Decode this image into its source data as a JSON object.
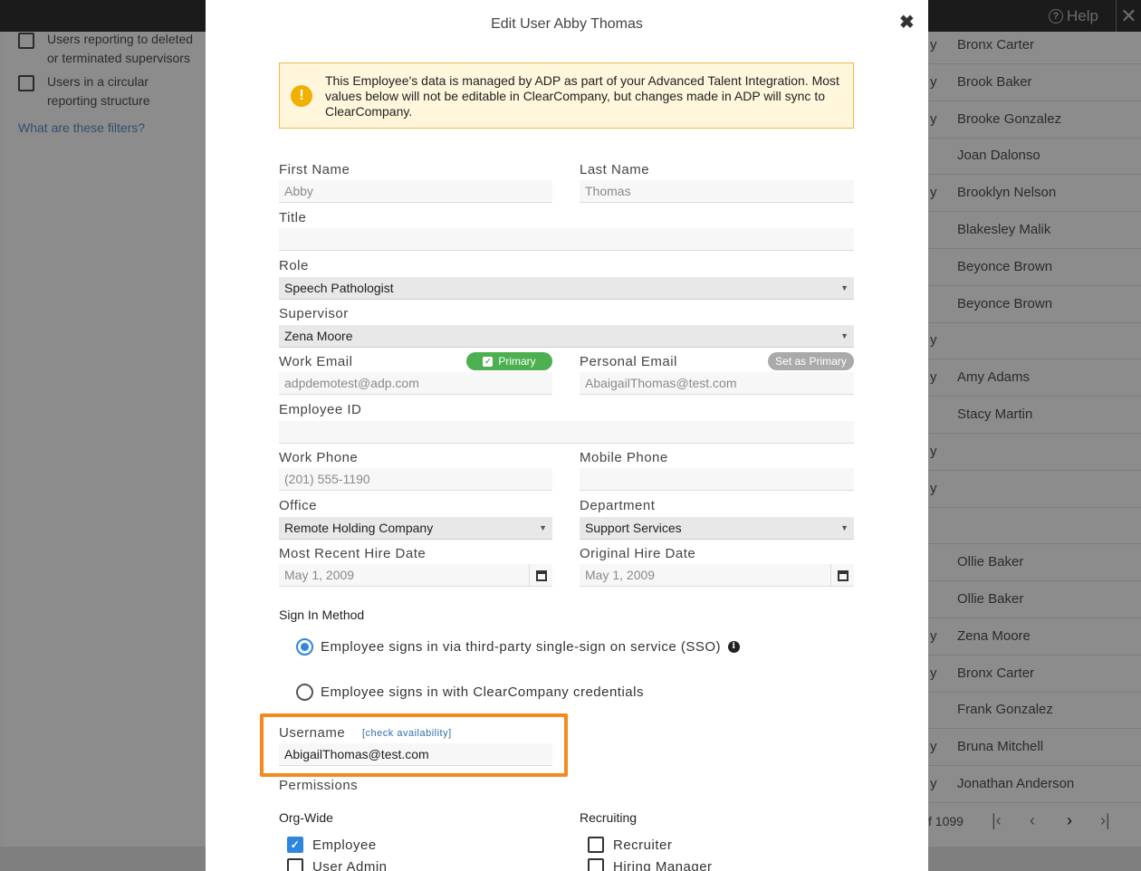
{
  "background": {
    "help_label": "Help",
    "filters": [
      {
        "line1": "Users reporting to deleted",
        "line2": "or terminated supervisors"
      },
      {
        "line1": "Users in a circular",
        "line2": "reporting structure"
      }
    ],
    "filters_link": "What are these filters?",
    "rows": [
      {
        "suffix": "y",
        "name": "Bronx Carter"
      },
      {
        "suffix": "y",
        "name": "Brook Baker"
      },
      {
        "suffix": "y",
        "name": "Brooke Gonzalez"
      },
      {
        "suffix": "",
        "name": "Joan Dalonso"
      },
      {
        "suffix": "y",
        "name": "Brooklyn Nelson"
      },
      {
        "suffix": "",
        "name": "Blakesley Malik"
      },
      {
        "suffix": "",
        "name": "Beyonce Brown"
      },
      {
        "suffix": "",
        "name": "Beyonce Brown"
      },
      {
        "suffix": "y",
        "name": ""
      },
      {
        "suffix": "y",
        "name": "Amy Adams"
      },
      {
        "suffix": "",
        "name": "Stacy Martin"
      },
      {
        "suffix": "y",
        "name": ""
      },
      {
        "suffix": "y",
        "name": ""
      },
      {
        "suffix": "",
        "name": ""
      },
      {
        "suffix": "",
        "name": "Ollie Baker"
      },
      {
        "suffix": "",
        "name": "Ollie Baker"
      },
      {
        "suffix": "y",
        "name": "Zena Moore"
      },
      {
        "suffix": "y",
        "name": "Bronx Carter"
      },
      {
        "suffix": "",
        "name": "Frank Gonzalez"
      },
      {
        "suffix": "y",
        "name": "Bruna Mitchell"
      },
      {
        "suffix": "y",
        "name": "Jonathan Anderson"
      }
    ],
    "pager_text": "f 1099"
  },
  "modal": {
    "title": "Edit User Abby Thomas",
    "alert_text": "This Employee's data is managed by ADP as part of your Advanced Talent Integration. Most values below will not be editable in ClearCompany, but changes made in ADP will sync to ClearCompany.",
    "first_name": {
      "label": "First Name",
      "value": "Abby"
    },
    "last_name": {
      "label": "Last Name",
      "value": "Thomas"
    },
    "title_field": {
      "label": "Title",
      "value": ""
    },
    "role": {
      "label": "Role",
      "value": "Speech Pathologist"
    },
    "supervisor": {
      "label": "Supervisor",
      "value": "Zena Moore"
    },
    "work_email": {
      "label": "Work Email",
      "value": "adpdemotest@adp.com",
      "badge": "Primary"
    },
    "personal_email": {
      "label": "Personal Email",
      "value": "AbaigailThomas@test.com",
      "badge": "Set as Primary"
    },
    "employee_id": {
      "label": "Employee ID",
      "value": ""
    },
    "work_phone": {
      "label": "Work Phone",
      "value": "(201) 555-1190"
    },
    "mobile_phone": {
      "label": "Mobile Phone",
      "value": ""
    },
    "office": {
      "label": "Office",
      "value": "Remote Holding Company"
    },
    "department": {
      "label": "Department",
      "value": "Support Services"
    },
    "recent_hire": {
      "label": "Most Recent Hire Date",
      "value": "May 1, 2009"
    },
    "original_hire": {
      "label": "Original Hire Date",
      "value": "May 1, 2009"
    },
    "sign_in": {
      "title": "Sign In Method",
      "sso_label": "Employee signs in via third-party single-sign on service (SSO)",
      "cc_label": "Employee signs in with ClearCompany credentials",
      "selected": "sso"
    },
    "username": {
      "label": "Username",
      "check_link": "[check availability]",
      "value": "AbigailThomas@test.com"
    },
    "permissions": {
      "title": "Permissions",
      "org_wide_title": "Org-Wide",
      "recruiting_title": "Recruiting",
      "org_wide": [
        {
          "label": "Employee",
          "checked": true
        },
        {
          "label": "User Admin",
          "checked": false
        }
      ],
      "recruiting": [
        {
          "label": "Recruiter",
          "checked": false
        },
        {
          "label": "Hiring Manager",
          "checked": false
        }
      ]
    }
  }
}
